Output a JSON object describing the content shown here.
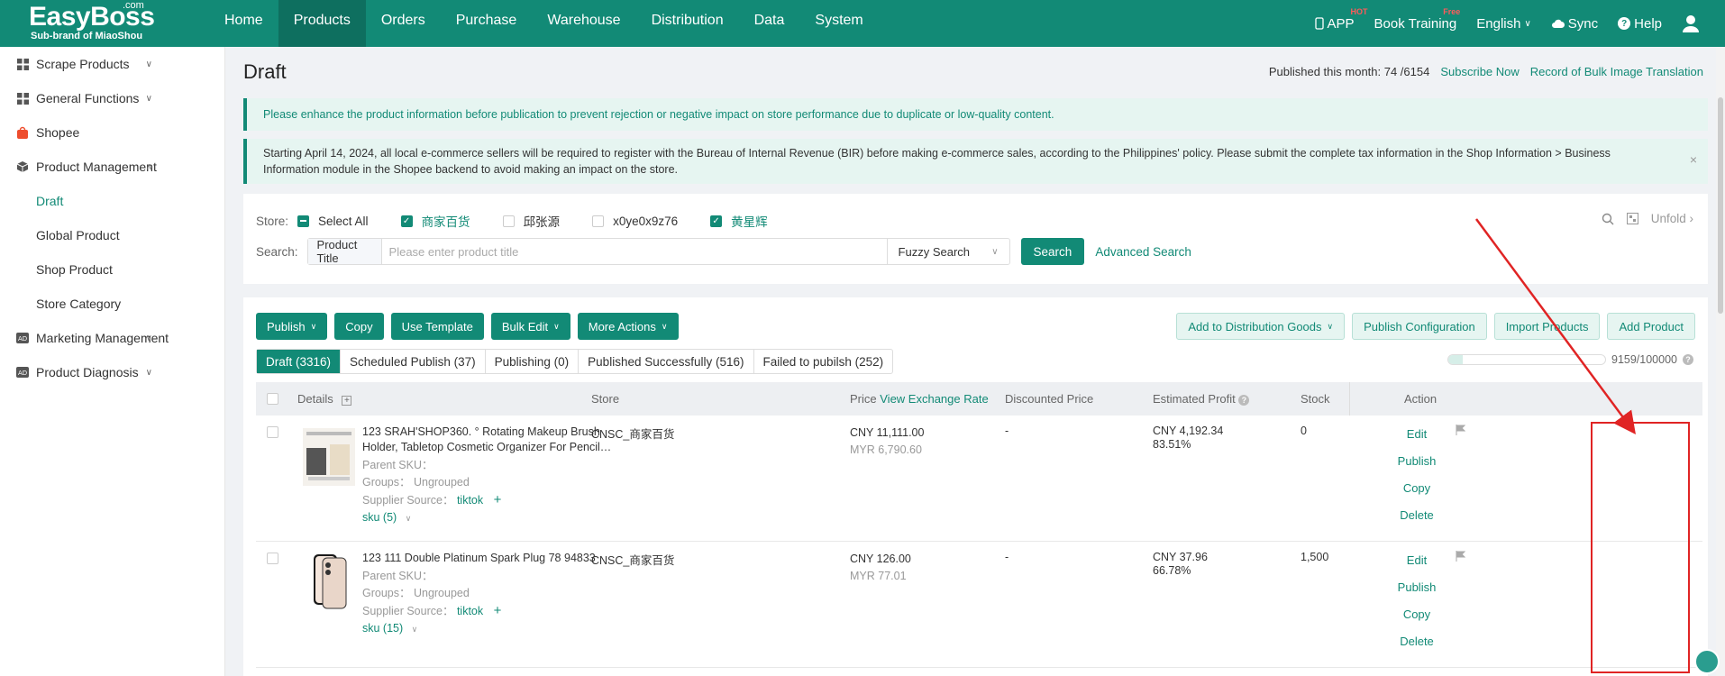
{
  "brand": {
    "name": "EasyBoss",
    "suffix": ".com",
    "sub": "Sub-brand of MiaoShou"
  },
  "nav": {
    "items": [
      "Home",
      "Products",
      "Orders",
      "Purchase",
      "Warehouse",
      "Distribution",
      "Data",
      "System"
    ],
    "active": "Products",
    "app": "APP",
    "app_badge": "HOT",
    "training": "Book Training",
    "training_badge": "Free",
    "language": "English",
    "sync": "Sync",
    "help": "Help"
  },
  "sidebar": {
    "items": [
      {
        "label": "Scrape Products",
        "icon": "grid-icon",
        "chevron": "down"
      },
      {
        "label": "General Functions",
        "icon": "grid-icon",
        "chevron": "down"
      },
      {
        "label": "Shopee",
        "icon": "shopee-bag-icon"
      },
      {
        "label": "Product Management",
        "icon": "box-icon",
        "chevron": "up"
      }
    ],
    "sub_items": [
      "Draft",
      "Global Product",
      "Shop Product",
      "Store Category"
    ],
    "active_sub": "Draft",
    "bottom_items": [
      {
        "label": "Marketing Management",
        "icon": "ad-icon",
        "chevron": "down"
      },
      {
        "label": "Product Diagnosis",
        "icon": "ad-icon",
        "chevron": "down"
      }
    ]
  },
  "page": {
    "title": "Draft",
    "published_label": "Published this month: 74 /6154",
    "subscribe": "Subscribe Now",
    "record": "Record of Bulk Image Translation"
  },
  "notices": {
    "n1": "Please enhance the product information before publication to prevent rejection or negative impact on store performance due to duplicate or low-quality content.",
    "n2": "Starting April 14, 2024, all local e-commerce sellers will be required to register with the Bureau of Internal Revenue (BIR) before making e-commerce sales, according to the Philippines' policy. Please submit the complete tax information in the Shop Information > Business Information module in the Shopee backend to avoid making an impact on the store."
  },
  "filter": {
    "store_label": "Store:",
    "select_all": "Select All",
    "stores": [
      {
        "name": "商家百货",
        "checked": true
      },
      {
        "name": "邱张源",
        "checked": false
      },
      {
        "name": "x0ye0x9z76",
        "checked": false
      },
      {
        "name": "黄星辉",
        "checked": true
      }
    ],
    "search_label": "Search:",
    "search_field": "Product Title",
    "search_placeholder": "Please enter product title",
    "search_mode": "Fuzzy Search",
    "search_button": "Search",
    "advanced": "Advanced Search",
    "unfold": "Unfold"
  },
  "toolbar": {
    "publish": "Publish",
    "copy": "Copy",
    "use_template": "Use Template",
    "bulk_edit": "Bulk Edit",
    "more_actions": "More Actions",
    "add_distribution": "Add to Distribution Goods",
    "publish_config": "Publish Configuration",
    "import": "Import Products",
    "add_product": "Add Product"
  },
  "tabs": [
    {
      "label": "Draft (3316)",
      "active": true
    },
    {
      "label": "Scheduled Publish (37)"
    },
    {
      "label": "Publishing (0)"
    },
    {
      "label": "Published Successfully (516)"
    },
    {
      "label": "Failed to pubilsh (252)"
    }
  ],
  "quota": {
    "text": "9159/100000",
    "fraction": 0.0916
  },
  "table": {
    "headers": {
      "details": "Details",
      "store": "Store",
      "price": "Price",
      "exchange": "View Exchange Rate",
      "discounted": "Discounted Price",
      "profit": "Estimated Profit",
      "stock": "Stock",
      "action": "Action"
    },
    "rows": [
      {
        "title": "123 SRAH'SHOP360. ° Rotating Makeup Brush Holder, Tabletop Cosmetic Organizer For Pencil…",
        "parent_sku": "Parent SKU：",
        "groups": "Groups：  Ungrouped",
        "supplier_label": "Supplier Source：",
        "supplier": "tiktok",
        "sku": "sku (5)",
        "store": "CNSC_商家百货",
        "price": "CNY 11,111.00",
        "price_myr": "MYR 6,790.60",
        "discounted": "-",
        "profit": "CNY 4,192.34",
        "profit_pct": "83.51%",
        "stock": "0",
        "actions": [
          "Edit",
          "Publish",
          "Copy",
          "Delete"
        ]
      },
      {
        "title": "123 111 Double Platinum Spark Plug 78 94833",
        "parent_sku": "Parent SKU：",
        "groups": "Groups：  Ungrouped",
        "supplier_label": "Supplier Source：",
        "supplier": "tiktok",
        "sku": "sku (15)",
        "store": "CNSC_商家百货",
        "price": "CNY 126.00",
        "price_myr": "MYR 77.01",
        "discounted": "-",
        "profit": "CNY 37.96",
        "profit_pct": "66.78%",
        "stock": "1,500",
        "actions": [
          "Edit",
          "Publish",
          "Copy",
          "Delete"
        ]
      }
    ]
  },
  "colors": {
    "primary": "#128a76",
    "annotation": "#e02424"
  }
}
